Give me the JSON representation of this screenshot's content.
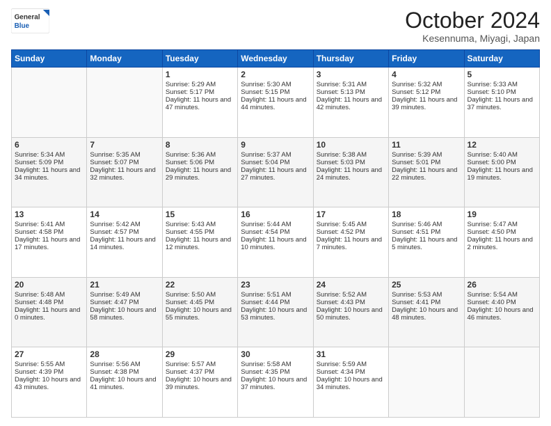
{
  "logo": {
    "line1": "General",
    "line2": "Blue"
  },
  "title": "October 2024",
  "subtitle": "Kesennuma, Miyagi, Japan",
  "weekdays": [
    "Sunday",
    "Monday",
    "Tuesday",
    "Wednesday",
    "Thursday",
    "Friday",
    "Saturday"
  ],
  "weeks": [
    [
      {
        "day": "",
        "info": ""
      },
      {
        "day": "",
        "info": ""
      },
      {
        "day": "1",
        "info": "Sunrise: 5:29 AM\nSunset: 5:17 PM\nDaylight: 11 hours and 47 minutes."
      },
      {
        "day": "2",
        "info": "Sunrise: 5:30 AM\nSunset: 5:15 PM\nDaylight: 11 hours and 44 minutes."
      },
      {
        "day": "3",
        "info": "Sunrise: 5:31 AM\nSunset: 5:13 PM\nDaylight: 11 hours and 42 minutes."
      },
      {
        "day": "4",
        "info": "Sunrise: 5:32 AM\nSunset: 5:12 PM\nDaylight: 11 hours and 39 minutes."
      },
      {
        "day": "5",
        "info": "Sunrise: 5:33 AM\nSunset: 5:10 PM\nDaylight: 11 hours and 37 minutes."
      }
    ],
    [
      {
        "day": "6",
        "info": "Sunrise: 5:34 AM\nSunset: 5:09 PM\nDaylight: 11 hours and 34 minutes."
      },
      {
        "day": "7",
        "info": "Sunrise: 5:35 AM\nSunset: 5:07 PM\nDaylight: 11 hours and 32 minutes."
      },
      {
        "day": "8",
        "info": "Sunrise: 5:36 AM\nSunset: 5:06 PM\nDaylight: 11 hours and 29 minutes."
      },
      {
        "day": "9",
        "info": "Sunrise: 5:37 AM\nSunset: 5:04 PM\nDaylight: 11 hours and 27 minutes."
      },
      {
        "day": "10",
        "info": "Sunrise: 5:38 AM\nSunset: 5:03 PM\nDaylight: 11 hours and 24 minutes."
      },
      {
        "day": "11",
        "info": "Sunrise: 5:39 AM\nSunset: 5:01 PM\nDaylight: 11 hours and 22 minutes."
      },
      {
        "day": "12",
        "info": "Sunrise: 5:40 AM\nSunset: 5:00 PM\nDaylight: 11 hours and 19 minutes."
      }
    ],
    [
      {
        "day": "13",
        "info": "Sunrise: 5:41 AM\nSunset: 4:58 PM\nDaylight: 11 hours and 17 minutes."
      },
      {
        "day": "14",
        "info": "Sunrise: 5:42 AM\nSunset: 4:57 PM\nDaylight: 11 hours and 14 minutes."
      },
      {
        "day": "15",
        "info": "Sunrise: 5:43 AM\nSunset: 4:55 PM\nDaylight: 11 hours and 12 minutes."
      },
      {
        "day": "16",
        "info": "Sunrise: 5:44 AM\nSunset: 4:54 PM\nDaylight: 11 hours and 10 minutes."
      },
      {
        "day": "17",
        "info": "Sunrise: 5:45 AM\nSunset: 4:52 PM\nDaylight: 11 hours and 7 minutes."
      },
      {
        "day": "18",
        "info": "Sunrise: 5:46 AM\nSunset: 4:51 PM\nDaylight: 11 hours and 5 minutes."
      },
      {
        "day": "19",
        "info": "Sunrise: 5:47 AM\nSunset: 4:50 PM\nDaylight: 11 hours and 2 minutes."
      }
    ],
    [
      {
        "day": "20",
        "info": "Sunrise: 5:48 AM\nSunset: 4:48 PM\nDaylight: 11 hours and 0 minutes."
      },
      {
        "day": "21",
        "info": "Sunrise: 5:49 AM\nSunset: 4:47 PM\nDaylight: 10 hours and 58 minutes."
      },
      {
        "day": "22",
        "info": "Sunrise: 5:50 AM\nSunset: 4:45 PM\nDaylight: 10 hours and 55 minutes."
      },
      {
        "day": "23",
        "info": "Sunrise: 5:51 AM\nSunset: 4:44 PM\nDaylight: 10 hours and 53 minutes."
      },
      {
        "day": "24",
        "info": "Sunrise: 5:52 AM\nSunset: 4:43 PM\nDaylight: 10 hours and 50 minutes."
      },
      {
        "day": "25",
        "info": "Sunrise: 5:53 AM\nSunset: 4:41 PM\nDaylight: 10 hours and 48 minutes."
      },
      {
        "day": "26",
        "info": "Sunrise: 5:54 AM\nSunset: 4:40 PM\nDaylight: 10 hours and 46 minutes."
      }
    ],
    [
      {
        "day": "27",
        "info": "Sunrise: 5:55 AM\nSunset: 4:39 PM\nDaylight: 10 hours and 43 minutes."
      },
      {
        "day": "28",
        "info": "Sunrise: 5:56 AM\nSunset: 4:38 PM\nDaylight: 10 hours and 41 minutes."
      },
      {
        "day": "29",
        "info": "Sunrise: 5:57 AM\nSunset: 4:37 PM\nDaylight: 10 hours and 39 minutes."
      },
      {
        "day": "30",
        "info": "Sunrise: 5:58 AM\nSunset: 4:35 PM\nDaylight: 10 hours and 37 minutes."
      },
      {
        "day": "31",
        "info": "Sunrise: 5:59 AM\nSunset: 4:34 PM\nDaylight: 10 hours and 34 minutes."
      },
      {
        "day": "",
        "info": ""
      },
      {
        "day": "",
        "info": ""
      }
    ]
  ]
}
